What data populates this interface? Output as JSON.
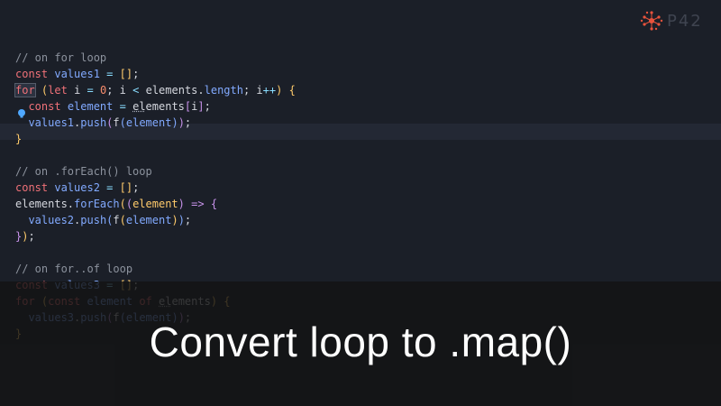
{
  "editor": {
    "lines": [
      {
        "segments": [
          {
            "c": "cmt",
            "t": "// on for loop"
          }
        ]
      },
      {
        "segments": [
          {
            "c": "kw",
            "t": "const"
          },
          {
            "c": "plain",
            "t": " "
          },
          {
            "c": "var",
            "t": "values1"
          },
          {
            "c": "plain",
            "t": " "
          },
          {
            "c": "op",
            "t": "="
          },
          {
            "c": "plain",
            "t": " "
          },
          {
            "c": "br1",
            "t": "[]"
          },
          {
            "c": "plain",
            "t": ";"
          }
        ]
      },
      {
        "segments": [
          {
            "c": "kw sel",
            "t": "for"
          },
          {
            "c": "plain",
            "t": " "
          },
          {
            "c": "br1",
            "t": "("
          },
          {
            "c": "kw",
            "t": "let"
          },
          {
            "c": "plain",
            "t": " i "
          },
          {
            "c": "op",
            "t": "="
          },
          {
            "c": "plain",
            "t": " "
          },
          {
            "c": "num",
            "t": "0"
          },
          {
            "c": "plain",
            "t": "; i "
          },
          {
            "c": "op",
            "t": "<"
          },
          {
            "c": "plain",
            "t": " elements."
          },
          {
            "c": "prop",
            "t": "length"
          },
          {
            "c": "plain",
            "t": "; i"
          },
          {
            "c": "op",
            "t": "++"
          },
          {
            "c": "br1",
            "t": ")"
          },
          {
            "c": "plain",
            "t": " "
          },
          {
            "c": "br1",
            "t": "{"
          }
        ]
      },
      {
        "segments": [
          {
            "c": "plain",
            "t": "  "
          },
          {
            "c": "kw",
            "t": "const"
          },
          {
            "c": "plain",
            "t": " "
          },
          {
            "c": "var",
            "t": "element"
          },
          {
            "c": "plain",
            "t": " "
          },
          {
            "c": "op",
            "t": "="
          },
          {
            "c": "plain",
            "t": " "
          },
          {
            "c": "plain dots",
            "t": "el"
          },
          {
            "c": "plain",
            "t": "ements"
          },
          {
            "c": "br2",
            "t": "["
          },
          {
            "c": "plain",
            "t": "i"
          },
          {
            "c": "br2",
            "t": "]"
          },
          {
            "c": "plain",
            "t": ";"
          }
        ]
      },
      {
        "segments": [
          {
            "c": "plain",
            "t": "  "
          },
          {
            "c": "var",
            "t": "values1"
          },
          {
            "c": "plain",
            "t": "."
          },
          {
            "c": "prop",
            "t": "push"
          },
          {
            "c": "br2",
            "t": "("
          },
          {
            "c": "plain",
            "t": "f"
          },
          {
            "c": "br3",
            "t": "("
          },
          {
            "c": "var",
            "t": "element"
          },
          {
            "c": "br3",
            "t": ")"
          },
          {
            "c": "br2",
            "t": ")"
          },
          {
            "c": "plain",
            "t": ";"
          }
        ]
      },
      {
        "segments": [
          {
            "c": "br1",
            "t": "}"
          }
        ]
      },
      {
        "segments": [
          {
            "c": "plain",
            "t": ""
          }
        ]
      },
      {
        "segments": [
          {
            "c": "cmt",
            "t": "// on .forEach() loop"
          }
        ]
      },
      {
        "segments": [
          {
            "c": "kw",
            "t": "const"
          },
          {
            "c": "plain",
            "t": " "
          },
          {
            "c": "var",
            "t": "values2"
          },
          {
            "c": "plain",
            "t": " "
          },
          {
            "c": "op",
            "t": "="
          },
          {
            "c": "plain",
            "t": " "
          },
          {
            "c": "br1",
            "t": "[]"
          },
          {
            "c": "plain",
            "t": ";"
          }
        ]
      },
      {
        "segments": [
          {
            "c": "plain",
            "t": "elements."
          },
          {
            "c": "prop",
            "t": "forEach"
          },
          {
            "c": "br1",
            "t": "("
          },
          {
            "c": "br2",
            "t": "("
          },
          {
            "c": "param",
            "t": "element"
          },
          {
            "c": "br2",
            "t": ")"
          },
          {
            "c": "plain",
            "t": " "
          },
          {
            "c": "kw2",
            "t": "=>"
          },
          {
            "c": "plain",
            "t": " "
          },
          {
            "c": "br2",
            "t": "{"
          }
        ]
      },
      {
        "segments": [
          {
            "c": "plain",
            "t": "  "
          },
          {
            "c": "var",
            "t": "values2"
          },
          {
            "c": "plain",
            "t": "."
          },
          {
            "c": "prop",
            "t": "push"
          },
          {
            "c": "br3",
            "t": "("
          },
          {
            "c": "plain",
            "t": "f"
          },
          {
            "c": "br1",
            "t": "("
          },
          {
            "c": "var",
            "t": "element"
          },
          {
            "c": "br1",
            "t": ")"
          },
          {
            "c": "br3",
            "t": ")"
          },
          {
            "c": "plain",
            "t": ";"
          }
        ]
      },
      {
        "segments": [
          {
            "c": "br2",
            "t": "}"
          },
          {
            "c": "br1",
            "t": ")"
          },
          {
            "c": "plain",
            "t": ";"
          }
        ]
      },
      {
        "segments": [
          {
            "c": "plain",
            "t": ""
          }
        ]
      },
      {
        "segments": [
          {
            "c": "cmt",
            "t": "// on for..of loop"
          }
        ]
      },
      {
        "segments": [
          {
            "c": "kw",
            "t": "const"
          },
          {
            "c": "plain",
            "t": " "
          },
          {
            "c": "var",
            "t": "values3"
          },
          {
            "c": "plain",
            "t": " "
          },
          {
            "c": "op",
            "t": "="
          },
          {
            "c": "plain",
            "t": " "
          },
          {
            "c": "br1",
            "t": "[]"
          },
          {
            "c": "plain",
            "t": ";"
          }
        ]
      },
      {
        "segments": [
          {
            "c": "kw",
            "t": "for"
          },
          {
            "c": "plain",
            "t": " "
          },
          {
            "c": "br1",
            "t": "("
          },
          {
            "c": "kw",
            "t": "const"
          },
          {
            "c": "plain",
            "t": " "
          },
          {
            "c": "var",
            "t": "element"
          },
          {
            "c": "plain",
            "t": " "
          },
          {
            "c": "kw",
            "t": "of"
          },
          {
            "c": "plain",
            "t": " "
          },
          {
            "c": "plain dots",
            "t": "el"
          },
          {
            "c": "plain",
            "t": "ements"
          },
          {
            "c": "br1",
            "t": ")"
          },
          {
            "c": "plain",
            "t": " "
          },
          {
            "c": "br1",
            "t": "{"
          }
        ]
      },
      {
        "segments": [
          {
            "c": "plain",
            "t": "  "
          },
          {
            "c": "var",
            "t": "values3"
          },
          {
            "c": "plain",
            "t": "."
          },
          {
            "c": "prop",
            "t": "push"
          },
          {
            "c": "br2",
            "t": "("
          },
          {
            "c": "plain",
            "t": "f"
          },
          {
            "c": "br3",
            "t": "("
          },
          {
            "c": "var",
            "t": "element"
          },
          {
            "c": "br3",
            "t": ")"
          },
          {
            "c": "br2",
            "t": ")"
          },
          {
            "c": "plain",
            "t": ";"
          }
        ]
      },
      {
        "segments": [
          {
            "c": "br1",
            "t": "}"
          }
        ]
      }
    ]
  },
  "caption": "Convert loop to .map()",
  "logo": {
    "text": "P42",
    "icon": "p42-logo-icon",
    "accent": "#e8533c"
  },
  "colors": {
    "background": "#1b1f28",
    "comment": "#8c929d",
    "keyword": "#f07178",
    "variable": "#82aaff"
  }
}
